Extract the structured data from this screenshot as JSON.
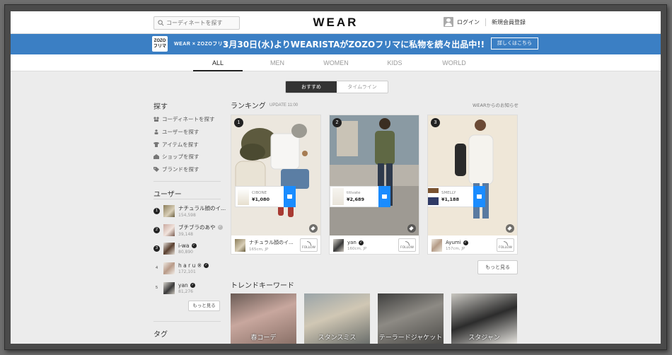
{
  "header": {
    "search_placeholder": "コーディネートを探す",
    "logo": "WEAR",
    "login": "ログイン",
    "register": "新規会員登録"
  },
  "banner": {
    "icon_text_1": "ZOZO",
    "icon_text_2": "フリマ",
    "brand": "WEAR × ZOZOフリマ",
    "text": "3月30日(水)よりWEARISTAがZOZOフリマに私物を続々出品中!!",
    "button": "詳しくはこちら",
    "color": "#3b7fc4"
  },
  "categories": [
    "ALL",
    "MEN",
    "WOMEN",
    "KIDS",
    "WORLD"
  ],
  "active_category": "ALL",
  "toggle": {
    "recommended": "おすすめ",
    "timeline": "タイムライン"
  },
  "sidebar": {
    "search_heading": "探す",
    "links": [
      {
        "label": "コーディネートを探す",
        "icon": "coordinate-icon"
      },
      {
        "label": "ユーザーを探す",
        "icon": "user-icon"
      },
      {
        "label": "アイテムを探す",
        "icon": "shirt-icon"
      },
      {
        "label": "ショップを探す",
        "icon": "shop-icon"
      },
      {
        "label": "ブランドを探す",
        "icon": "tag-icon"
      }
    ],
    "users_heading": "ユーザー",
    "users": [
      {
        "rank": "1",
        "name": "ナチュラル顔のイ...",
        "followers": "154,598"
      },
      {
        "rank": "2",
        "name": "ブチブラのあや",
        "followers": "39,148"
      },
      {
        "rank": "3",
        "name": "i-wa",
        "followers": "80,890"
      },
      {
        "rank": "4",
        "name": "h a r u ※",
        "followers": "172,101"
      },
      {
        "rank": "5",
        "name": "yan",
        "followers": "81,276"
      }
    ],
    "more": "もっと見る",
    "tag_heading": "タグ"
  },
  "ranking": {
    "title": "ランキング",
    "update": "UPDATE 11:00",
    "notice": "WEARからのお知らせ",
    "more": "もっと見る",
    "cards": [
      {
        "rank": "1",
        "brand": "CIBONE",
        "price": "¥1,080",
        "user": "ナチュラル顔のイ...",
        "meta": "165cm, JP",
        "follow": "FOLLOW"
      },
      {
        "rank": "2",
        "brand": "titivate",
        "price": "¥2,689",
        "user": "yan",
        "meta": "160cm, JP",
        "follow": "FOLLOW"
      },
      {
        "rank": "3",
        "brand": "SMELLY",
        "price": "¥1,188",
        "user": "Ayumi",
        "meta": "157cm, JP",
        "follow": "FOLLOW"
      }
    ]
  },
  "trend": {
    "title": "トレンドキーワード",
    "keywords": [
      "春コーデ",
      "スタンスミス",
      "テーラードジャケット",
      "スタジャン"
    ]
  }
}
